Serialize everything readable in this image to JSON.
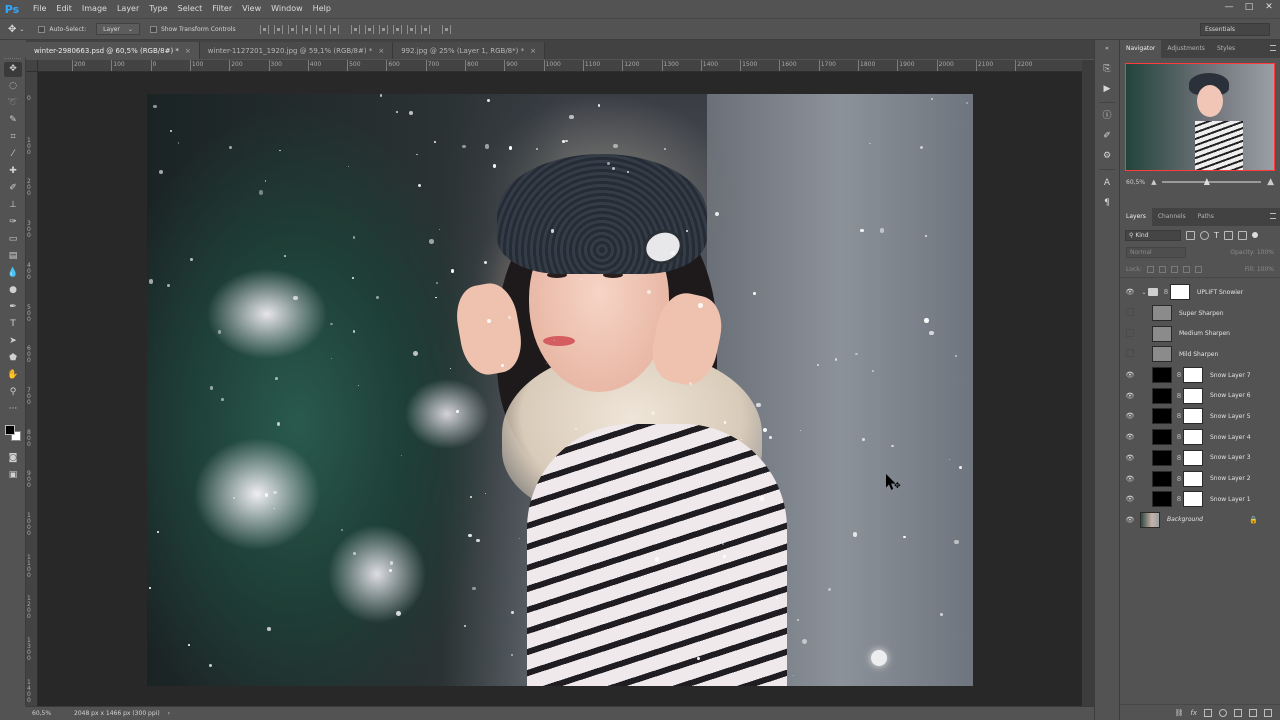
{
  "app": {
    "logo": "Ps"
  },
  "menu": [
    "File",
    "Edit",
    "Image",
    "Layer",
    "Type",
    "Select",
    "Filter",
    "View",
    "Window",
    "Help"
  ],
  "window_controls": {
    "minimize": "—",
    "maximize": "□",
    "close": "✕"
  },
  "options_bar": {
    "auto_select_label": "Auto-Select:",
    "auto_select_value": "Layer",
    "show_transform_label": "Show Transform Controls",
    "workspace": "Essentials"
  },
  "tabs": [
    {
      "label": "winter-2980663.psd @ 60,5% (RGB/8#) *",
      "close": "×",
      "active": true
    },
    {
      "label": "winter-1127201_1920.jpg @ 59,1% (RGB/8#) *",
      "close": "×",
      "active": false
    },
    {
      "label": "992.jpg @ 25% (Layer 1, RGB/8*) *",
      "close": "×",
      "active": false
    }
  ],
  "ruler_top_ticks": [
    "200",
    "100",
    "0",
    "100",
    "200",
    "300",
    "400",
    "500",
    "600",
    "700",
    "800",
    "900",
    "1000",
    "1100",
    "1200",
    "1300",
    "1400",
    "1500",
    "1600",
    "1700",
    "1800",
    "1900",
    "2000",
    "2100",
    "2200"
  ],
  "ruler_left_ticks": [
    "0",
    "100",
    "200",
    "300",
    "400",
    "500",
    "600",
    "700",
    "800",
    "900",
    "1000",
    "1100",
    "1200",
    "1300",
    "1400"
  ],
  "status": {
    "zoom": "60,5%",
    "doc_info": "2048 px x 1466 px (300 ppi)"
  },
  "panels": {
    "top_tabs": [
      "Navigator",
      "Adjustments",
      "Styles"
    ],
    "navigator_zoom": "60,5%",
    "navigator_zoom_level": 0.45,
    "layer_tabs": [
      "Layers",
      "Channels",
      "Paths"
    ],
    "kind_filter": "Kind",
    "blend_mode": "Normal",
    "opacity_label": "Opacity:",
    "opacity_value": "100%",
    "lock_label": "Lock:",
    "fill_label": "Fill:",
    "fill_value": "100%"
  },
  "layers": [
    {
      "name": "UPLIFT Snowier",
      "visible": true,
      "type": "group"
    },
    {
      "name": "Super Sharpen",
      "visible": false,
      "type": "gray"
    },
    {
      "name": "Medium Sharpen",
      "visible": false,
      "type": "gray"
    },
    {
      "name": "Mild Sharpen",
      "visible": false,
      "type": "gray"
    },
    {
      "name": "Snow Layer 7",
      "visible": true,
      "type": "masked"
    },
    {
      "name": "Snow Layer 6",
      "visible": true,
      "type": "masked"
    },
    {
      "name": "Snow Layer 5",
      "visible": true,
      "type": "masked"
    },
    {
      "name": "Snow Layer 4",
      "visible": true,
      "type": "masked"
    },
    {
      "name": "Snow Layer 3",
      "visible": true,
      "type": "masked"
    },
    {
      "name": "Snow Layer 2",
      "visible": true,
      "type": "masked"
    },
    {
      "name": "Snow Layer 1",
      "visible": true,
      "type": "masked"
    },
    {
      "name": "Background",
      "visible": true,
      "type": "background"
    }
  ],
  "icons": {
    "eye": "👁",
    "chain": "8",
    "lock": "🔒"
  }
}
